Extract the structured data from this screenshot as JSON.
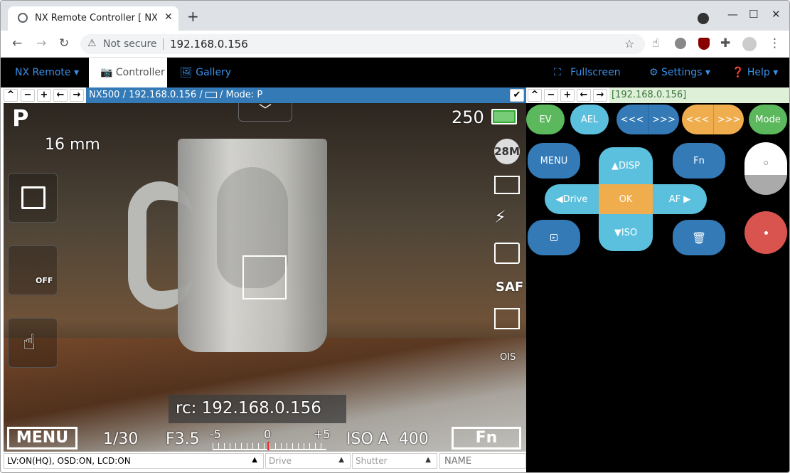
{
  "browser": {
    "tab_title": "NX Remote Controller [ NX",
    "new_tab": "+",
    "not_secure": "Not secure",
    "url": "192.168.0.156"
  },
  "nav": {
    "brand": "NX Remote",
    "controller": "Controller",
    "gallery": "Gallery",
    "fullscreen": "Fullscreen",
    "settings": "Settings",
    "help": "Help"
  },
  "left_bar": {
    "path": "NX500 / 192.168.0.156 / ",
    "mode": " / Mode: P"
  },
  "right_bar": {
    "ip": "[192.168.0.156]"
  },
  "lcd": {
    "mode": "P",
    "focal": "16 mm",
    "shots": "250",
    "size": "28M",
    "rc_text": "rc: 192.168.0.156",
    "menu": "MENU",
    "shutter": "1/30",
    "aperture": "F3.5",
    "ev_minus": "-5",
    "ev_zero": "0",
    "ev_plus": "+5",
    "iso": "ISO A  400",
    "fn": "Fn",
    "saf": "SAF",
    "ois": "OIS",
    "off": "OFF",
    "battery_level": 1.0
  },
  "status": {
    "lv": "LV:ON(HQ), OSD:ON, LCD:ON",
    "drive": "Drive",
    "shutter": "Shutter",
    "name_placeholder": "NAME"
  },
  "controls": {
    "ev": "EV",
    "ael": "AEL",
    "prev": "<<<",
    "next": ">>>",
    "mode": "Mode",
    "menu": "MENU",
    "fn": "Fn",
    "disp": "DISP",
    "drive": "Drive",
    "ok": "OK",
    "af": "AF",
    "iso": "ISO"
  },
  "colors": {
    "green": "#5cb85c",
    "light_blue": "#5bc0de",
    "dark_blue": "#337ab7",
    "orange": "#f0ad4e",
    "red": "#d9534f",
    "nav_link": "#3a8fe8",
    "bar_blue": "#337ab7",
    "bar_green": "#dff0d8"
  }
}
